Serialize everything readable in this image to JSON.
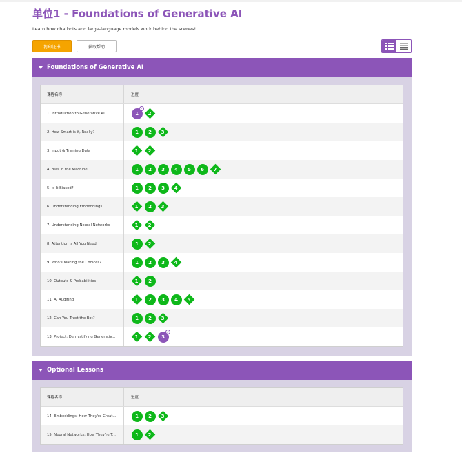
{
  "page": {
    "title": "单位1 - Foundations of Generative AI",
    "subtitle": "Learn how chatbots and large-language models work behind the scenes!",
    "print_button": "打印证书",
    "help_button": "获取帮助"
  },
  "colors": {
    "accent": "#8c55b8",
    "progress_green": "#0eb81a",
    "print_button": "#f5a400"
  },
  "units": [
    {
      "title": "Foundations of Generative AI",
      "col_lesson": "课程名称",
      "col_progress": "进度",
      "lessons": [
        {
          "name": "1. Introduction to Generative AI",
          "levels": [
            {
              "n": "1",
              "shape": "circle",
              "state": "current"
            },
            {
              "n": "2",
              "shape": "diamond"
            }
          ]
        },
        {
          "name": "2. How Smart is it, Really?",
          "levels": [
            {
              "n": "1",
              "shape": "circle"
            },
            {
              "n": "2",
              "shape": "circle"
            },
            {
              "n": "3",
              "shape": "diamond"
            }
          ]
        },
        {
          "name": "3. Input & Training Data",
          "levels": [
            {
              "n": "1",
              "shape": "diamond"
            },
            {
              "n": "2",
              "shape": "diamond"
            }
          ]
        },
        {
          "name": "4. Bias in the Machine",
          "levels": [
            {
              "n": "1",
              "shape": "circle"
            },
            {
              "n": "2",
              "shape": "circle"
            },
            {
              "n": "3",
              "shape": "circle"
            },
            {
              "n": "4",
              "shape": "circle"
            },
            {
              "n": "5",
              "shape": "circle"
            },
            {
              "n": "6",
              "shape": "circle"
            },
            {
              "n": "7",
              "shape": "diamond"
            }
          ]
        },
        {
          "name": "5. Is It Biased?",
          "levels": [
            {
              "n": "1",
              "shape": "circle"
            },
            {
              "n": "2",
              "shape": "circle"
            },
            {
              "n": "3",
              "shape": "circle"
            },
            {
              "n": "4",
              "shape": "diamond"
            }
          ]
        },
        {
          "name": "6. Understanding Embeddings",
          "levels": [
            {
              "n": "1",
              "shape": "diamond"
            },
            {
              "n": "2",
              "shape": "circle"
            },
            {
              "n": "3",
              "shape": "diamond"
            }
          ]
        },
        {
          "name": "7. Understanding Neural Networks",
          "levels": [
            {
              "n": "1",
              "shape": "diamond"
            },
            {
              "n": "2",
              "shape": "diamond"
            }
          ]
        },
        {
          "name": "8. Attention is All You Need",
          "levels": [
            {
              "n": "1",
              "shape": "circle"
            },
            {
              "n": "2",
              "shape": "diamond"
            }
          ]
        },
        {
          "name": "9. Who's Making the Choices?",
          "levels": [
            {
              "n": "1",
              "shape": "circle"
            },
            {
              "n": "2",
              "shape": "circle"
            },
            {
              "n": "3",
              "shape": "circle"
            },
            {
              "n": "4",
              "shape": "diamond"
            }
          ]
        },
        {
          "name": "10. Outputs & Probabilities",
          "levels": [
            {
              "n": "1",
              "shape": "diamond"
            },
            {
              "n": "2",
              "shape": "circle"
            }
          ]
        },
        {
          "name": "11. AI Auditing",
          "levels": [
            {
              "n": "1",
              "shape": "diamond"
            },
            {
              "n": "2",
              "shape": "circle"
            },
            {
              "n": "3",
              "shape": "circle"
            },
            {
              "n": "4",
              "shape": "circle"
            },
            {
              "n": "5",
              "shape": "diamond"
            }
          ]
        },
        {
          "name": "12. Can You Trust the Bot?",
          "levels": [
            {
              "n": "1",
              "shape": "circle"
            },
            {
              "n": "2",
              "shape": "circle"
            },
            {
              "n": "3",
              "shape": "diamond"
            }
          ]
        },
        {
          "name": "13. Project: Demystifying Generativ...",
          "levels": [
            {
              "n": "1",
              "shape": "diamond"
            },
            {
              "n": "2",
              "shape": "diamond"
            },
            {
              "n": "3",
              "shape": "circle",
              "state": "current"
            }
          ]
        }
      ]
    },
    {
      "title": "Optional Lessons",
      "col_lesson": "课程名称",
      "col_progress": "进度",
      "lessons": [
        {
          "name": "14. Embeddings: How They're Creat...",
          "levels": [
            {
              "n": "1",
              "shape": "circle"
            },
            {
              "n": "2",
              "shape": "circle"
            },
            {
              "n": "3",
              "shape": "diamond"
            }
          ]
        },
        {
          "name": "15. Neural Networks: How They're T...",
          "levels": [
            {
              "n": "1",
              "shape": "circle"
            },
            {
              "n": "2",
              "shape": "diamond"
            }
          ]
        }
      ]
    }
  ]
}
